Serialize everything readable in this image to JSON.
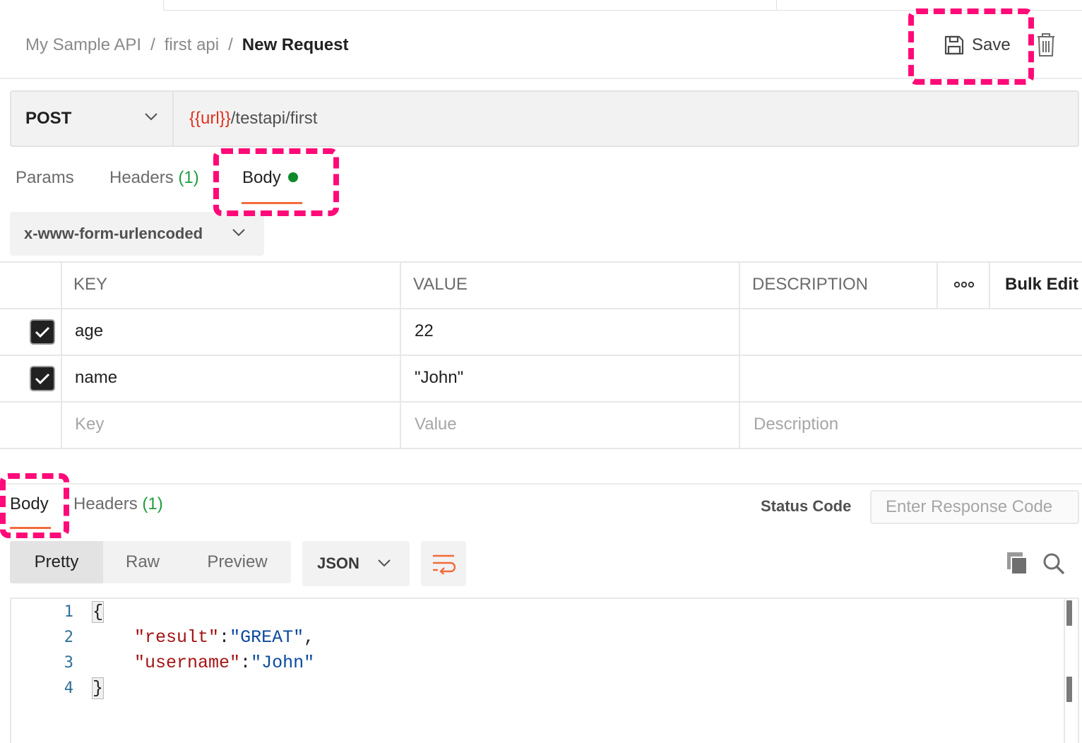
{
  "breadcrumb": {
    "collection": "My Sample API",
    "folder": "first api",
    "separator": "/",
    "request": "New Request"
  },
  "toolbar": {
    "save_label": "Save",
    "save_icon": "floppy-disk-icon",
    "delete_icon": "trash-icon"
  },
  "request": {
    "method": "POST",
    "url_variable": "{{url}}",
    "url_path": "/testapi/first"
  },
  "request_tabs": {
    "params": "Params",
    "headers": "Headers",
    "headers_count": "(1)",
    "body": "Body",
    "active": "Body"
  },
  "body_type": "x-www-form-urlencoded",
  "table": {
    "headers": [
      "KEY",
      "VALUE",
      "DESCRIPTION"
    ],
    "more_icon": "more-options-icon",
    "bulk_edit": "Bulk Edit",
    "rows": [
      {
        "checked": true,
        "key": "age",
        "value": "22",
        "description": ""
      },
      {
        "checked": true,
        "key": "name",
        "value": "\"John\"",
        "description": ""
      }
    ],
    "placeholders": {
      "key": "Key",
      "value": "Value",
      "description": "Description"
    }
  },
  "response": {
    "tabs": {
      "body": "Body",
      "headers": "Headers",
      "headers_count": "(1)",
      "active": "Body"
    },
    "status_label": "Status Code",
    "status_placeholder": "Enter Response Code",
    "view_modes": [
      "Pretty",
      "Raw",
      "Preview"
    ],
    "active_view": "Pretty",
    "language": "JSON",
    "wrap_icon": "wrap-lines-icon",
    "copy_icon": "copy-icon",
    "search_icon": "search-icon",
    "line_numbers": [
      "1",
      "2",
      "3",
      "4"
    ],
    "code": {
      "open_brace": "{",
      "k1": "\"result\"",
      "v1": "\"GREAT\"",
      "k2": "\"username\"",
      "v2": "\"John\"",
      "close_brace": "}"
    }
  },
  "colors": {
    "accent": "#f26b3a",
    "annotation": "#ff0a78",
    "variable": "#e0321e",
    "count_green": "#1f9d3f",
    "dot_green": "#0e8a2a"
  }
}
